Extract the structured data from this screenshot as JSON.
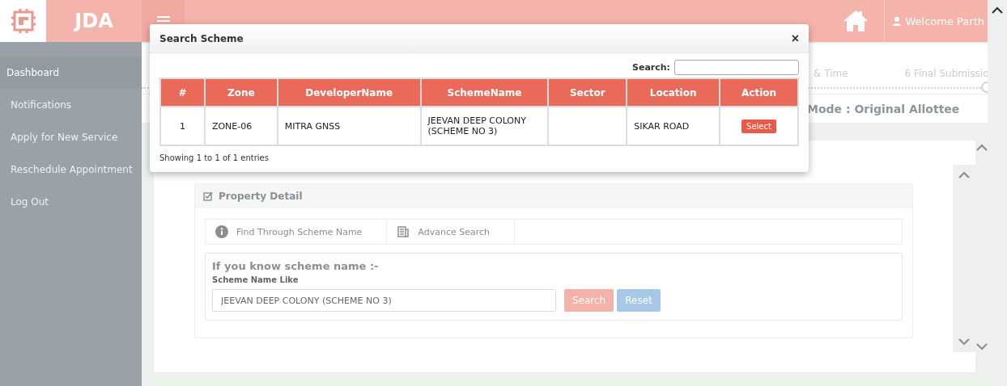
{
  "header": {
    "brand": "JDA",
    "welcome": "Welcome Parth"
  },
  "sidebar": {
    "items": [
      {
        "label": "Dashboard",
        "selected": true
      },
      {
        "label": "Notifications",
        "selected": false
      },
      {
        "label": "Apply for New Service",
        "selected": false
      },
      {
        "label": "Reschedule Appointment",
        "selected": false
      },
      {
        "label": "Log Out",
        "selected": false
      }
    ]
  },
  "steps": [
    "& Time",
    "6 Final Submissio"
  ],
  "mode": "Mode : Original Allottee",
  "property_detail": {
    "title": "Property Detail",
    "tabs": [
      {
        "label": "Find Through Scheme Name",
        "kind": "info"
      },
      {
        "label": "Advance Search",
        "kind": "grid"
      }
    ],
    "heading": "If you know scheme name :-",
    "field_label": "Scheme Name Like",
    "field_value": "JEEVAN DEEP COLONY (SCHEME NO 3)",
    "buttons": [
      {
        "label": "Search",
        "kind": "primary"
      },
      {
        "label": "Reset",
        "kind": "secondary"
      }
    ]
  },
  "modal": {
    "title": "Search Scheme",
    "close": "×",
    "search_label": "Search:",
    "columns": [
      "#",
      "Zone",
      "DeveloperName",
      "SchemeName",
      "Sector",
      "Location",
      "Action"
    ],
    "rows": [
      {
        "cells": [
          "1",
          "ZONE-06",
          "MITRA GNSS",
          "JEEVAN DEEP COLONY (SCHEME NO 3)",
          "",
          "SIKAR ROAD"
        ],
        "action": "Select"
      }
    ],
    "footer": "Showing 1 to 1 of 1 entries"
  }
}
